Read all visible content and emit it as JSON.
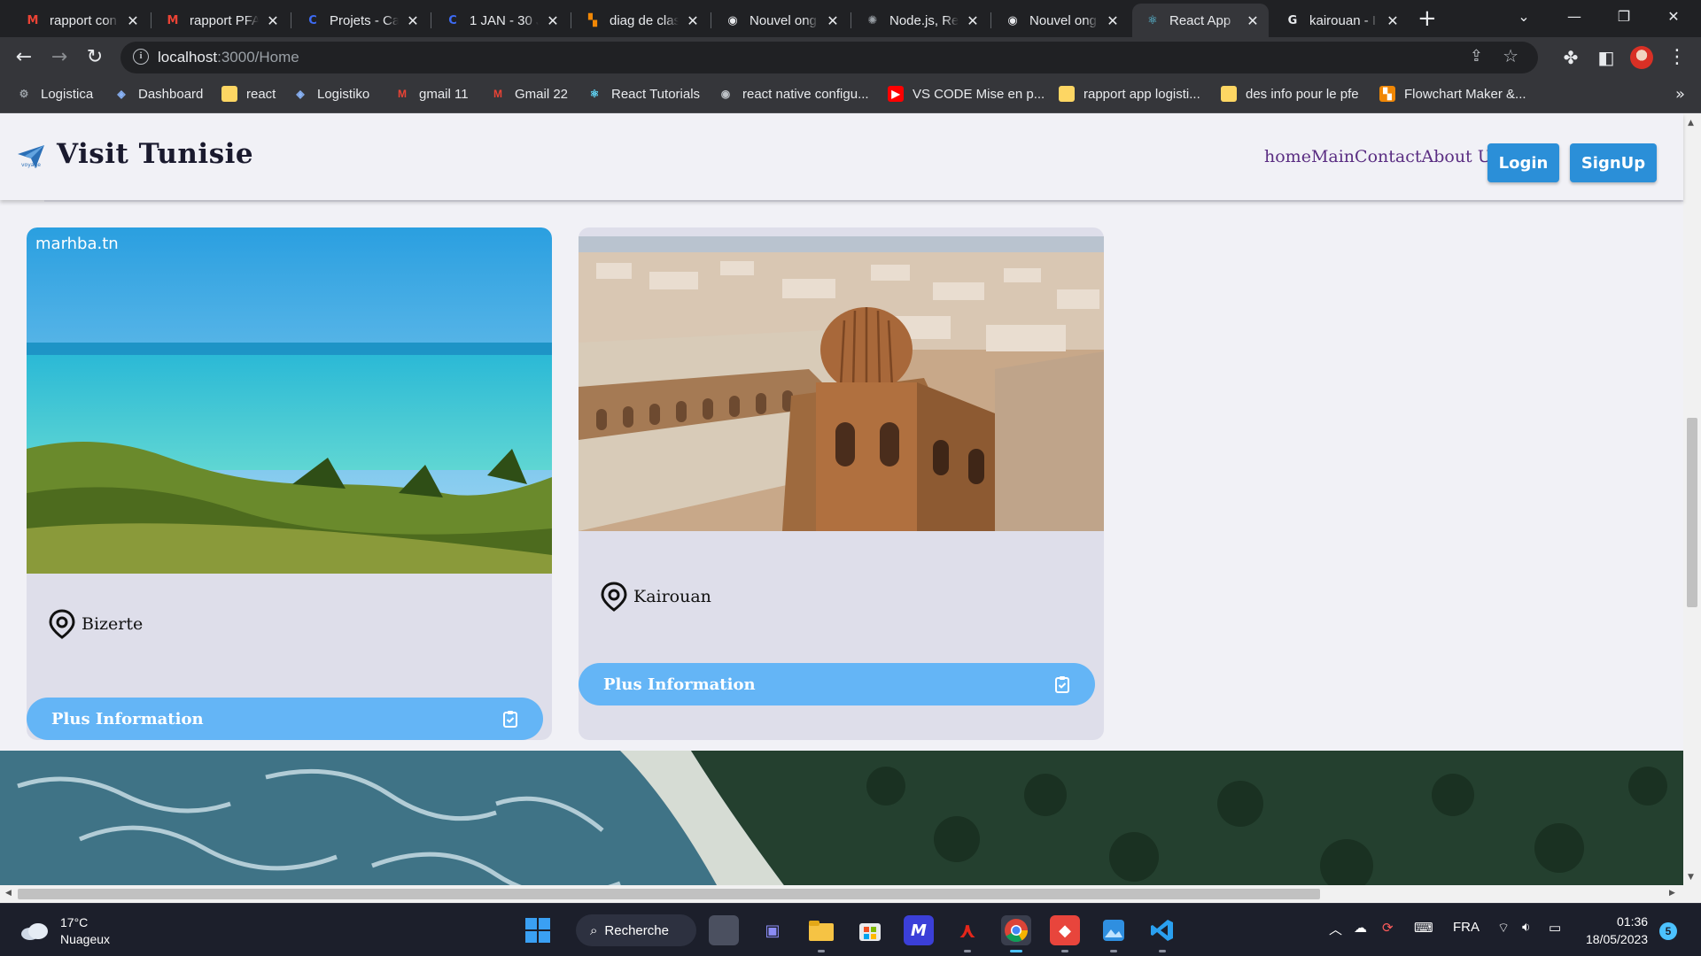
{
  "browser": {
    "tabs": [
      {
        "title": "rapport con",
        "icon": "gmail-icon",
        "color": "#ea4335",
        "glyph": "M"
      },
      {
        "title": "rapport PFA",
        "icon": "gmail-icon",
        "color": "#ea4335",
        "glyph": "M"
      },
      {
        "title": "Projets - Ca",
        "icon": "canva-icon",
        "color": "#3d6bf5",
        "glyph": "C"
      },
      {
        "title": "1 JAN - 30 J",
        "icon": "canva-icon",
        "color": "#3d6bf5",
        "glyph": "C"
      },
      {
        "title": "diag de clas",
        "icon": "drawio-icon",
        "color": "#f08705",
        "glyph": "▚"
      },
      {
        "title": "Nouvel ong",
        "icon": "chrome-icon",
        "color": "#e8eaed",
        "glyph": "◉"
      },
      {
        "title": "Node.js, Re",
        "icon": "chatgpt-icon",
        "color": "#9aa0a6",
        "glyph": "✺"
      },
      {
        "title": "Nouvel ong",
        "icon": "chrome-icon",
        "color": "#e8eaed",
        "glyph": "◉"
      },
      {
        "title": "React App",
        "icon": "react-icon",
        "color": "#61dafb",
        "glyph": "⚛",
        "active": true
      },
      {
        "title": "kairouan - I",
        "icon": "google-icon",
        "color": "#e8eaed",
        "glyph": "G"
      }
    ],
    "url_host": "localhost",
    "url_path": ":3000/Home",
    "bookmarks": [
      {
        "label": "Logistica",
        "icon": "gear-icon"
      },
      {
        "label": "Dashboard",
        "icon": "app-icon"
      },
      {
        "label": "react",
        "icon": "folder-icon"
      },
      {
        "label": "Logistiko",
        "icon": "app-icon"
      },
      {
        "label": "gmail 11",
        "icon": "gmail-icon"
      },
      {
        "label": "Gmail 22",
        "icon": "gmail-icon"
      },
      {
        "label": "React Tutorials",
        "icon": "react-icon"
      },
      {
        "label": "react native configu...",
        "icon": "chrome-icon"
      },
      {
        "label": "VS CODE Mise en p...",
        "icon": "youtube-icon"
      },
      {
        "label": "rapport app logisti...",
        "icon": "folder-icon"
      },
      {
        "label": "des info pour le pfe",
        "icon": "folder-icon"
      },
      {
        "label": "Flowchart Maker &...",
        "icon": "drawio-icon"
      }
    ]
  },
  "site": {
    "brand": "Visit Tunisie",
    "nav": [
      {
        "label": "home"
      },
      {
        "label": "Main"
      },
      {
        "label": "Contact"
      },
      {
        "label": "About Us"
      }
    ],
    "login_label": "Login",
    "signup_label": "SignUp",
    "cards": [
      {
        "location": "Bizerte",
        "button_label": "Plus Information",
        "watermark": "marhba.tn"
      },
      {
        "location": "Kairouan",
        "button_label": "Plus Information"
      }
    ]
  },
  "taskbar": {
    "temperature": "17°C",
    "weather": "Nuageux",
    "search_label": "Recherche",
    "language": "FRA",
    "time": "01:36",
    "date": "18/05/2023",
    "notifications": "5"
  },
  "colors": {
    "accent_blue": "#2b8fd8",
    "card_button": "#64b5f6",
    "nav_purple": "#5a2d82"
  }
}
